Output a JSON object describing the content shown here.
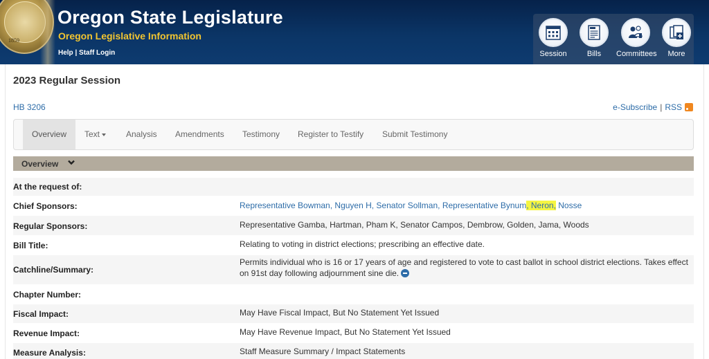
{
  "header": {
    "title": "Oregon State Legislature",
    "subtitle": "Oregon Legislative Information",
    "help": "Help",
    "separator": "|",
    "staff_login": "Staff Login",
    "seal_year": "1859",
    "nav": [
      {
        "label": "Session",
        "icon": "calendar-icon"
      },
      {
        "label": "Bills",
        "icon": "bill-document-icon"
      },
      {
        "label": "Committees",
        "icon": "committee-people-icon"
      },
      {
        "label": "More",
        "icon": "more-documents-icon"
      }
    ]
  },
  "page": {
    "session_title": "2023 Regular Session",
    "bill_number": "HB 3206",
    "esubscribe": "e-Subscribe",
    "sep": "|",
    "rss": "RSS"
  },
  "tabs": [
    {
      "label": "Overview",
      "active": true
    },
    {
      "label": "Text",
      "dropdown": true
    },
    {
      "label": "Analysis"
    },
    {
      "label": "Amendments"
    },
    {
      "label": "Testimony"
    },
    {
      "label": "Register to Testify"
    },
    {
      "label": "Submit Testimony"
    }
  ],
  "overview": {
    "header": "Overview",
    "rows": {
      "request": {
        "label": "At the request of:",
        "value": ""
      },
      "chief": {
        "label": "Chief Sponsors:",
        "part1": "Representative Bowman, Nguyen H, Senator Sollman, Representative Bynum",
        "highlight": ", Neron,",
        "part2": " Nosse"
      },
      "regular": {
        "label": "Regular Sponsors:",
        "value": "Representative Gamba, Hartman, Pham K, Senator Campos, Dembrow, Golden, Jama, Woods"
      },
      "title": {
        "label": "Bill Title:",
        "value": "Relating to voting in district elections; prescribing an effective date."
      },
      "catchline": {
        "label": "Catchline/Summary:",
        "value": "Permits individual who is 16 or 17 years of age and registered to vote to cast ballot in school district elections. Takes effect on 91st day following adjournment sine die."
      },
      "chapter": {
        "label": "Chapter Number:",
        "value": ""
      },
      "fiscal": {
        "label": "Fiscal Impact:",
        "value": "May Have Fiscal Impact, But No Statement Yet Issued"
      },
      "revenue": {
        "label": "Revenue Impact:",
        "value": "May Have Revenue Impact, But No Statement Yet Issued"
      },
      "measure": {
        "label": "Measure Analysis:",
        "value": "Staff Measure Summary / Impact Statements"
      }
    }
  },
  "colors": {
    "header_bg": "#0b3566",
    "subtitle": "#f2c530",
    "link": "#2d6ca8",
    "overview_bar": "#b3ab9d",
    "highlight": "#f5f542"
  }
}
